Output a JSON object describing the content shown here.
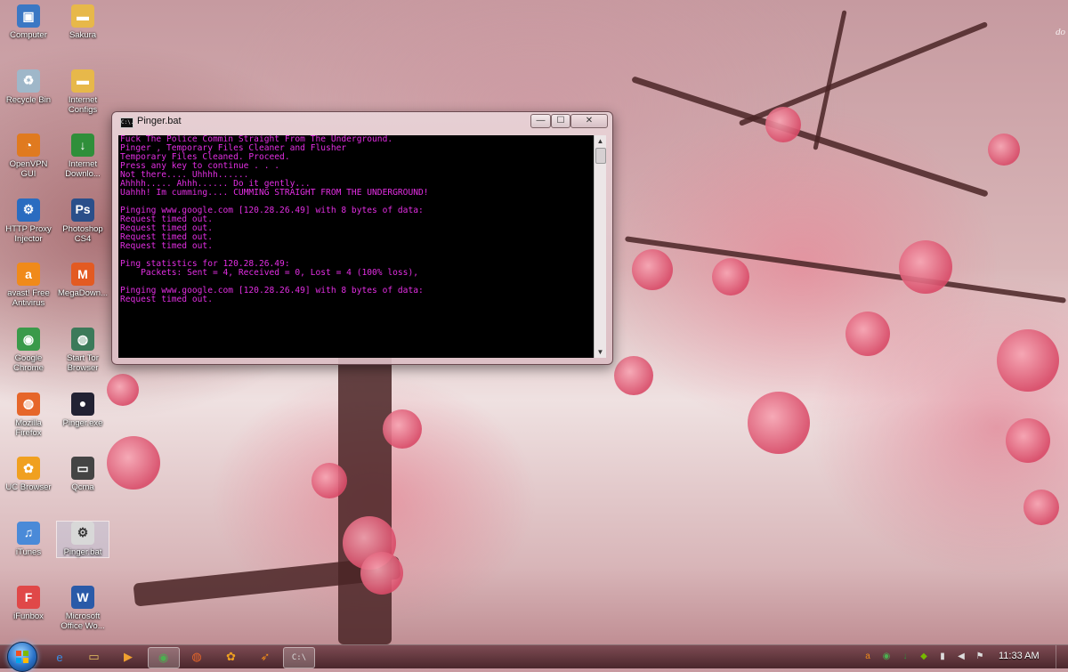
{
  "desktop": {
    "corner_text": "do",
    "icons": [
      {
        "label": "Computer",
        "icon": "computer-icon",
        "color": "#3b78c4"
      },
      {
        "label": "Sakura",
        "icon": "folder-icon",
        "color": "#e7b84a"
      },
      {
        "label": "Recycle Bin",
        "icon": "recycle-bin-icon",
        "color": "#9fb7c9"
      },
      {
        "label": "Internet Configs",
        "icon": "folder-icon",
        "color": "#e7b84a"
      },
      {
        "label": "OpenVPN GUI",
        "icon": "openvpn-icon",
        "color": "#e07a1f"
      },
      {
        "label": "Internet Downlo...",
        "icon": "idm-icon",
        "color": "#2f8f3a"
      },
      {
        "label": "HTTP Proxy Injector",
        "icon": "proxy-injector-icon",
        "color": "#2a6cc0"
      },
      {
        "label": "Photoshop CS4",
        "icon": "photoshop-icon",
        "color": "#2a4f8a"
      },
      {
        "label": "avast! Free Antivirus",
        "icon": "avast-icon",
        "color": "#f08a1a"
      },
      {
        "label": "MegaDown...",
        "icon": "megadownloader-icon",
        "color": "#e35a22"
      },
      {
        "label": "Google Chrome",
        "icon": "chrome-icon",
        "color": "#3a9a4a"
      },
      {
        "label": "Start Tor Browser",
        "icon": "tor-browser-icon",
        "color": "#3c7a5a"
      },
      {
        "label": "Mozilla Firefox",
        "icon": "firefox-icon",
        "color": "#e6662a"
      },
      {
        "label": "Pinger.exe",
        "icon": "pinger-exe-icon",
        "color": "#223"
      },
      {
        "label": "UC Browser",
        "icon": "uc-browser-icon",
        "color": "#f0a020"
      },
      {
        "label": "Qcma",
        "icon": "qcma-icon",
        "color": "#444"
      },
      {
        "label": "iTunes",
        "icon": "itunes-icon",
        "color": "#4a8ad8"
      },
      {
        "label": "Pinger.bat",
        "icon": "batch-file-icon",
        "color": "#d8d8d8"
      },
      {
        "label": "iFunbox",
        "icon": "ifunbox-icon",
        "color": "#e04848"
      },
      {
        "label": "Microsoft Office Wo...",
        "icon": "word-icon",
        "color": "#2a5aa8"
      }
    ]
  },
  "window": {
    "title": "Pinger.bat",
    "title_icon_text": "C:\\.",
    "minimize": "—",
    "maximize": "☐",
    "close": "✕",
    "console_text_color": "#e22ee2",
    "console_lines": [
      "Fuck The Police Commin Straight From The Underground.",
      "Pinger , Temporary Files Cleaner and Flusher",
      "Temporary Files Cleaned. Proceed.",
      "Press any key to continue . . .",
      "Not there.... Uhhhh......",
      "Ahhhh..... Ahhh...... Do it gently...",
      "Uahhh! Im cumming.... CUMMING STRAIGHT FROM THE UNDERGROUND!",
      "",
      "Pinging www.google.com [120.28.26.49] with 8 bytes of data:",
      "Request timed out.",
      "Request timed out.",
      "Request timed out.",
      "Request timed out.",
      "",
      "Ping statistics for 120.28.26.49:",
      "    Packets: Sent = 4, Received = 0, Lost = 4 (100% loss),",
      "",
      "Pinging www.google.com [120.28.26.49] with 8 bytes of data:",
      "Request timed out."
    ]
  },
  "taskbar": {
    "pinned": [
      {
        "name": "ie-taskbar-icon",
        "glyph": "e",
        "color": "#3a8ee6"
      },
      {
        "name": "explorer-taskbar-icon",
        "glyph": "▭",
        "color": "#e8c060"
      },
      {
        "name": "media-player-taskbar-icon",
        "glyph": "▶",
        "color": "#f0a030"
      },
      {
        "name": "chrome-taskbar-icon",
        "glyph": "◉",
        "color": "#4caf50"
      },
      {
        "name": "firefox-taskbar-icon",
        "glyph": "◍",
        "color": "#e6662a"
      },
      {
        "name": "uc-browser-taskbar-icon",
        "glyph": "✿",
        "color": "#f0a020"
      },
      {
        "name": "avast-taskbar-icon",
        "glyph": "➶",
        "color": "#f08a1a"
      },
      {
        "name": "cmd-taskbar-icon",
        "glyph": "C:\\",
        "color": "#dddddd"
      }
    ],
    "tray": [
      {
        "name": "avast-tray-icon",
        "glyph": "a",
        "color": "#f08a1a"
      },
      {
        "name": "chrome-tray-icon",
        "glyph": "◉",
        "color": "#4caf50"
      },
      {
        "name": "idm-tray-icon",
        "glyph": "↓",
        "color": "#2f8f3a"
      },
      {
        "name": "nvidia-tray-icon",
        "glyph": "◆",
        "color": "#76b900"
      },
      {
        "name": "network-tray-icon",
        "glyph": "▮",
        "color": "#dddddd"
      },
      {
        "name": "volume-tray-icon",
        "glyph": "◀",
        "color": "#dddddd"
      },
      {
        "name": "flag-tray-icon",
        "glyph": "⚑",
        "color": "#dddddd"
      }
    ],
    "clock": "11:33 AM"
  }
}
